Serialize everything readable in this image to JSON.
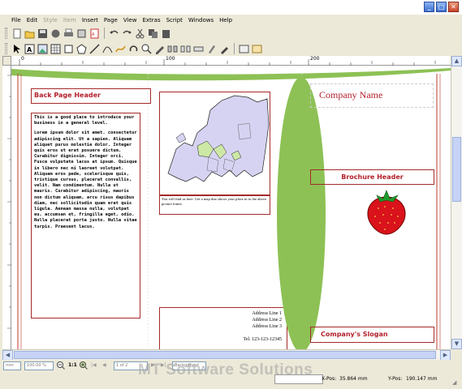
{
  "menu": [
    "File",
    "Edit",
    "Style",
    "Item",
    "Insert",
    "Page",
    "View",
    "Extras",
    "Script",
    "Windows",
    "Help"
  ],
  "menu_disabled": [
    "Style",
    "Item"
  ],
  "window_buttons": [
    "minimize-icon",
    "maximize-icon",
    "close-icon"
  ],
  "ruler_labels": [
    "0",
    "100",
    "200"
  ],
  "document": {
    "back_header": "Back Page Header",
    "body_intro": "This is a good place to introduce your business in a general level.",
    "body_text": "Lorem ipsum dolor sit amet. consectetur adipiscing elit. Ut a sapien. Aliquam aliquet purus molestie dolor. Integer quis eros ut erat posuere dictum. Curabitur dignissim. Integer orci. Fusce vulputate lacus at ipsum. Quisque in libero nec mi laoreet volutpat. Aliquam eros pede, scelerisque quis, tristique cursus, placerat convallis, velit. Nam condimentum. Nulla ut mauris. Curabitur adipiscing, mauris non dictum aliquam, arcu risus dapibus diam, nec sollicitudin quam erat quis ligula. Aenean massa nulla, volutpat eu, accumsan et, fringilla eget, odio. Nulla placerat porta justo. Nulla vitae turpis. Praesent lacus.",
    "map_caption": "You will find us here. Get a map that shows your place in to the above picture frame.",
    "address_lines": [
      "Address Line 1",
      "Address Line 2",
      "Address Line 3"
    ],
    "tel": "Tel. 123-123-12345",
    "company_name": "Company Name",
    "brochure_header": "Brochure Header",
    "slogan": "Company's Slogan"
  },
  "status": {
    "zoom": "100.00 %",
    "ratio": "1:1",
    "page": "1 of 2",
    "layer": "Background",
    "xpos_label": "X-Pos:",
    "xpos": "35.864 mm",
    "ypos_label": "Y-Pos:",
    "ypos": "190.147 mm",
    "watermark": "MT Software Solutions"
  },
  "colors": {
    "accent_red": "#b3202b",
    "leaf_green": "#8dc155",
    "map_fill": "#d6d3f2"
  }
}
